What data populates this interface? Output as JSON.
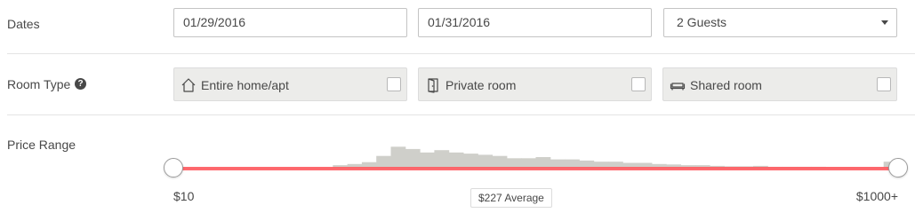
{
  "dates": {
    "label": "Dates",
    "checkin": "01/29/2016",
    "checkout": "01/31/2016",
    "guests": "2 Guests"
  },
  "room_type": {
    "label": "Room Type",
    "help_icon": "question-circle-icon",
    "options": [
      {
        "label": "Entire home/apt",
        "icon": "house-icon",
        "checked": false
      },
      {
        "label": "Private room",
        "icon": "door-icon",
        "checked": false
      },
      {
        "label": "Shared room",
        "icon": "sofa-icon",
        "checked": false
      }
    ]
  },
  "price_range": {
    "label": "Price Range",
    "min_label": "$10",
    "max_label": "$1000+",
    "average_label": "$227 Average",
    "selected_min_fraction": 0.0,
    "selected_max_fraction": 1.0,
    "histogram": [
      0.02,
      0.02,
      0.02,
      0.02,
      0.02,
      0.02,
      0.03,
      0.03,
      0.03,
      0.03,
      0.03,
      0.15,
      0.2,
      0.28,
      0.55,
      0.95,
      0.85,
      0.7,
      0.8,
      0.7,
      0.65,
      0.6,
      0.55,
      0.45,
      0.45,
      0.5,
      0.4,
      0.4,
      0.35,
      0.3,
      0.3,
      0.25,
      0.25,
      0.2,
      0.18,
      0.15,
      0.15,
      0.12,
      0.1,
      0.1,
      0.12,
      0.08,
      0.08,
      0.08,
      0.08,
      0.06,
      0.06,
      0.05,
      0.05,
      0.3
    ],
    "colors": {
      "track": "#ff5a5f",
      "histogram": "#cfcfca"
    }
  }
}
